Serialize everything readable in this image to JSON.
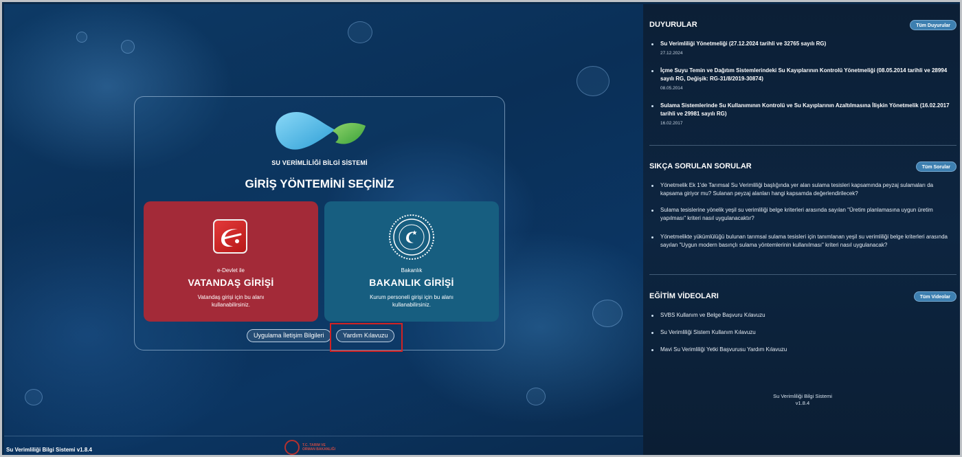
{
  "app": {
    "name": "SU VERİMLİLİĞİ BİLGİ SİSTEMİ",
    "bottom_label": "Su Verimliliği Bilgi Sistemi v1.8.4",
    "ministry_label_1": "T.C. TARIM VE",
    "ministry_label_2": "ORMAN BAKANLIĞI"
  },
  "login": {
    "title": "GİRİŞ YÖNTEMİNİ SEÇİNİZ",
    "citizen": {
      "sub": "e-Devlet ile",
      "main": "VATANDAŞ GİRİŞİ",
      "desc": "Vatandaş girişi için bu alanı kullanabilirsiniz."
    },
    "ministry": {
      "sub": "Bakanlık",
      "main": "BAKANLIK GİRİŞİ",
      "desc": "Kurum personeli girişi için bu alanı kullanabilirsiniz."
    },
    "contact_button": "Uygulama İletişim Bilgileri",
    "help_button": "Yardım Kılavuzu"
  },
  "announcements": {
    "title": "DUYURULAR",
    "all_button": "Tüm Duyurular",
    "items": [
      {
        "text": "Su Verimliliği Yönetmeliği (27.12.2024 tarihli ve 32765 sayılı RG)",
        "date": "27.12.2024"
      },
      {
        "text": "İçme Suyu Temin ve Dağıtım Sistemlerindeki Su Kayıplarının Kontrolü Yönetmeliği (08.05.2014 tarihli ve 28994 sayılı RG, Değişik: RG-31/8/2019-30874)",
        "date": "08.05.2014"
      },
      {
        "text": "Sulama Sistemlerinde Su Kullanımının Kontrolü ve Su Kayıplarının Azaltılmasına İlişkin Yönetmelik (16.02.2017 tarihli ve 29981 sayılı RG)",
        "date": "16.02.2017"
      }
    ]
  },
  "faq": {
    "title": "SIKÇA SORULAN SORULAR",
    "all_button": "Tüm Sorular",
    "items": [
      "Yönetmelik Ek 1'de Tarımsal Su Verimliliği başlığında yer alan sulama tesisleri kapsamında peyzaj sulamaları da kapsama giriyor mu? Sulanan peyzaj alanları hangi kapsamda değerlendirilecek?",
      "Sulama tesislerine yönelik yeşil su verimliliği belge kriterleri arasında sayılan \"Üretim planlamasına uygun üretim yapılması\" kriteri nasıl uygulanacaktır?",
      "Yönetmelikte yükümlülüğü bulunan tarımsal sulama tesisleri için tanımlanan yeşil su verimliliği belge kriterleri arasında sayılan \"Uygun modern basınçlı sulama yöntemlerinin kullanılması\" kriteri nasıl uygulanacak?"
    ]
  },
  "videos": {
    "title": "EĞİTİM VİDEOLARI",
    "all_button": "Tüm Videolar",
    "items": [
      "SVBS Kullanım ve Belge Başvuru Kılavuzu",
      "Su Verimliliği Sistem Kullanım Kılavuzu",
      "Mavi Su Verimliliği Yetki Başvurusu Yardım Kılavuzu"
    ]
  },
  "footer": {
    "name": "Su Verimliliği Bilgi Sistemi",
    "version": "v1.8.4"
  },
  "colors": {
    "citizen_card": "#a32a38",
    "ministry_card": "#175e80",
    "highlight_box": "#d32222",
    "right_panel": "#0d2540",
    "logo_blue": "#5bc0ee",
    "logo_green": "#5ab846"
  }
}
